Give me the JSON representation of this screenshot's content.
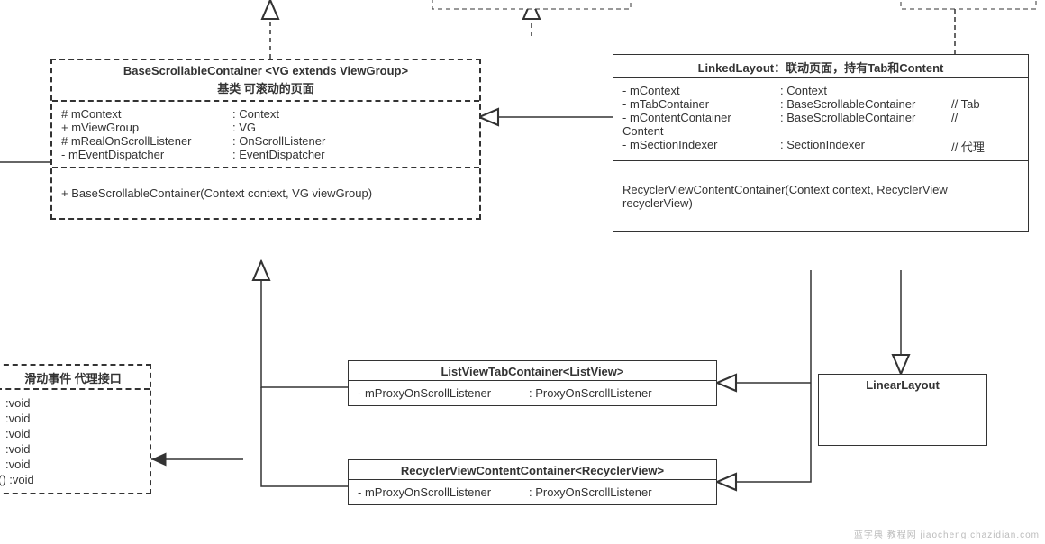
{
  "base": {
    "title": "BaseScrollableContainer <VG extends ViewGroup>",
    "subtitle": "基类  可滚动的页面",
    "fields": [
      {
        "vis": "# ",
        "name": "mContext",
        "type": ": Context"
      },
      {
        "vis": "+ ",
        "name": "mViewGroup",
        "type": ": VG"
      },
      {
        "vis": "# ",
        "name": "mRealOnScrollListener",
        "type": ": OnScrollListener"
      },
      {
        "vis": "-  ",
        "name": "mEventDispatcher",
        "type": ": EventDispatcher"
      }
    ],
    "methods": "+ BaseScrollableContainer(Context context, VG viewGroup)"
  },
  "linked": {
    "title": "LinkedLayout：联动页面，持有Tab和Content",
    "fields": [
      {
        "vis": "-  ",
        "name": "mContext",
        "type": ": Context",
        "cmt": ""
      },
      {
        "vis": "-  ",
        "name": "mTabContainer",
        "type": ": BaseScrollableContainer",
        "cmt": "  //  Tab"
      },
      {
        "vis": "-  ",
        "name": "mContentContainer",
        "type": ": BaseScrollableContainer",
        "cmt": "  //"
      }
    ],
    "extra_line": "Content",
    "fields2": [
      {
        "vis": "-  ",
        "name": "mSectionIndexer",
        "type": ": SectionIndexer",
        "cmt": "// 代理"
      }
    ],
    "methods": "RecyclerViewContentContainer(Context context, RecyclerView recyclerView)"
  },
  "listTab": {
    "title": "ListViewTabContainer<ListView>",
    "field": {
      "vis": "-  ",
      "name": "mProxyOnScrollListener",
      "type": ": ProxyOnScrollListener"
    }
  },
  "recyclerContent": {
    "title": "RecyclerViewContentContainer<RecyclerView>",
    "field": {
      "vis": "-  ",
      "name": "mProxyOnScrollListener",
      "type": ": ProxyOnScrollListener"
    }
  },
  "linear": {
    "title": "LinearLayout"
  },
  "proxyIface": {
    "title": "滑动事件 代理接口",
    "rows": [
      ":void",
      ":void",
      ":void",
      ":void",
      ":void",
      "()  :void"
    ]
  },
  "watermark": "蓝字典  教程网  jiaocheng.chazidian.com"
}
